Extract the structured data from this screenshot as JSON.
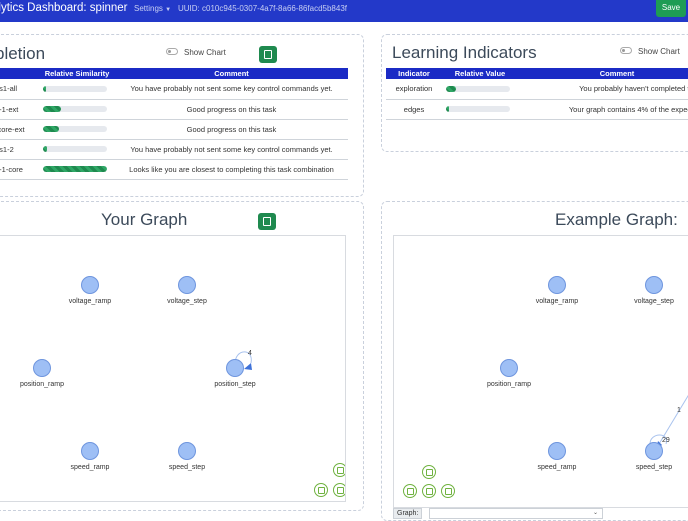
{
  "navbar": {
    "title": "alytics Dashboard: spinner",
    "settings_label": "Settings",
    "uuid_text": "UUID: c010c945-0307-4a7f-8a66-86facd5b843f",
    "save_label": "Save"
  },
  "completion": {
    "title": "pletion",
    "show_chart_label": "Show Chart",
    "columns": [
      "",
      "Relative Similarity",
      "Comment"
    ],
    "rows": [
      {
        "name": "es1-all",
        "similarity": 0.04,
        "comment": "You have probably not sent some key control commands yet."
      },
      {
        "name": "1-1-ext",
        "similarity": 0.28,
        "comment": "Good progress on this task"
      },
      {
        "name": "-core-ext",
        "similarity": 0.25,
        "comment": "Good progress on this task"
      },
      {
        "name": "es1-2",
        "similarity": 0.06,
        "comment": "You have probably not sent some key control commands yet."
      },
      {
        "name": "1-1-core",
        "similarity": 1.0,
        "comment": "Looks like you are closest to completing this task combination"
      }
    ]
  },
  "learning": {
    "title": "Learning Indicators",
    "show_chart_label": "Show Chart",
    "columns": [
      "Indicator",
      "Relative Value",
      "Comment"
    ],
    "rows": [
      {
        "name": "exploration",
        "value": 0.16,
        "comment": "You probably haven't completed the mai"
      },
      {
        "name": "edges",
        "value": 0.04,
        "comment": "Your graph contains 4% of the expected nu"
      }
    ]
  },
  "your_graph": {
    "title": "Your Graph",
    "nodes": [
      "voltage_ramp",
      "voltage_step",
      "position_ramp",
      "position_step",
      "speed_ramp",
      "speed_step"
    ],
    "self_loop_label": "4"
  },
  "example_graph": {
    "title": "Example Graph:",
    "nodes": [
      "voltage_ramp",
      "voltage_step",
      "position_ramp",
      "speed_ramp",
      "speed_step"
    ],
    "partial_node_label": "p",
    "edge_label": "1",
    "self_loop_label": "29",
    "graph_select_label": "Graph:"
  },
  "icons": {
    "fit": "fit-icon",
    "zoom_out": "zoom-out-icon",
    "zoom_in": "zoom-in-icon",
    "up": "up-arrow-icon",
    "left": "left-arrow-icon",
    "down": "down-arrow-icon",
    "right": "right-arrow-icon"
  },
  "colors": {
    "navbar": "#2339c9",
    "table_header": "#1b2bc5",
    "button_green": "#1e9c54",
    "node_fill": "#9ebff5"
  }
}
